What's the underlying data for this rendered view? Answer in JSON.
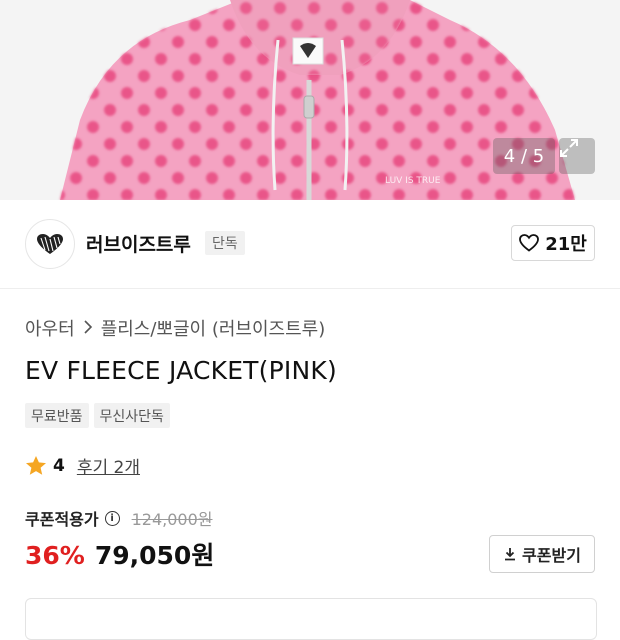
{
  "gallery": {
    "counter": "4 / 5",
    "watermark": "LUV IS TRUE"
  },
  "brand": {
    "name": "러브이즈트루",
    "badge": "단독",
    "likes": "21만"
  },
  "product": {
    "breadcrumb": [
      "아우터",
      "플리스/뽀글이 (러브이즈트루)"
    ],
    "title": "EV FLEECE JACKET(PINK)",
    "tags": [
      "무료반품",
      "무신사단독"
    ],
    "rating": "4",
    "reviews": "후기 2개"
  },
  "price": {
    "coupon_label": "쿠폰적용가",
    "original": "124,000원",
    "discount": "36%",
    "final": "79,050원",
    "coupon_button": "쿠폰받기"
  },
  "colors": {
    "accent_red": "#e02020",
    "star": "#f5a623",
    "jacket_pink": "#f4a3c2",
    "dot_pink": "#e8487f"
  }
}
